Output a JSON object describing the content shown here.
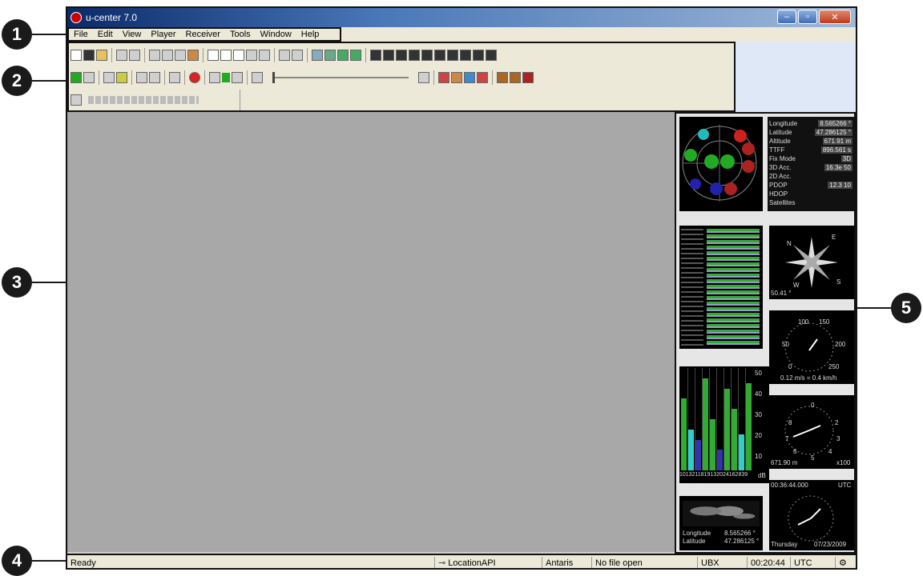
{
  "window": {
    "title": "u-center 7.0"
  },
  "menu": [
    "File",
    "Edit",
    "View",
    "Player",
    "Receiver",
    "Tools",
    "Window",
    "Help"
  ],
  "callouts": [
    "1",
    "2",
    "3",
    "4",
    "5"
  ],
  "status": {
    "ready": "Ready",
    "connection": "LocationAPI",
    "receiver": "Antaris",
    "file": "No file open",
    "protocol": "UBX",
    "time": "00:20:44",
    "timezone": "UTC"
  },
  "data_view": {
    "rows": [
      [
        "Longitude",
        "8.565266 °"
      ],
      [
        "Latitude",
        "47.286125 °"
      ],
      [
        "Altitude",
        "671.91 m"
      ],
      [
        "TTFF",
        "896.561 s"
      ],
      [
        "Fix Mode",
        "3D"
      ],
      [
        "3D Acc.",
        "16.3e 50"
      ],
      [
        "2D Acc.",
        ""
      ],
      [
        "PDOP",
        "12.3 10"
      ],
      [
        "HDOP",
        ""
      ],
      [
        "Satellites",
        ""
      ]
    ]
  },
  "compass": {
    "n": "N",
    "e": "E",
    "s": "S",
    "w": "W",
    "heading": "50.41 °"
  },
  "speed": {
    "t100": "100",
    "t150": "150",
    "t50": "50",
    "t200": "200",
    "t0": "0",
    "t250": "250",
    "readout": "0.12 m/s = 0.4 km/h"
  },
  "altimeter": {
    "t0": "0",
    "t8": "8",
    "t2": "2",
    "t7": "7",
    "t3": "3",
    "t6": "6",
    "t4": "4",
    "t5": "5",
    "readout": "671.90 m",
    "unit": "x100"
  },
  "clock": {
    "time": "00:36:44.000",
    "tz": "UTC",
    "day": "Thursday",
    "date": "07/23/2009"
  },
  "map": {
    "lon_label": "Longitude",
    "lon": "8.565266 °",
    "lat_label": "Latitude",
    "lat": "47.286125 °"
  },
  "signal": {
    "ticks": [
      "50",
      "40",
      "30",
      "20",
      "10"
    ],
    "xlabels": "1013211819132024162839",
    "unit": "dB"
  }
}
